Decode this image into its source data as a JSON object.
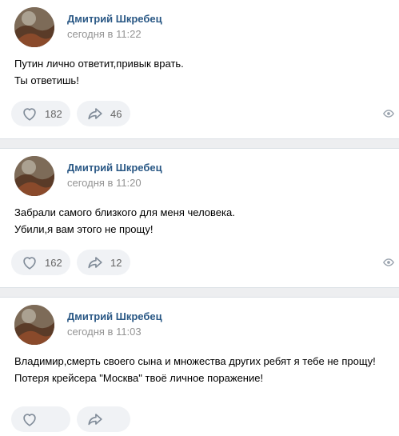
{
  "posts": [
    {
      "author": "Дмитрий Шкребец",
      "time": "сегодня в 11:22",
      "lines": [
        "Путин лично ответит,привык врать.",
        "Ты ответишь!"
      ],
      "likes": "182",
      "shares": "46"
    },
    {
      "author": "Дмитрий Шкребец",
      "time": "сегодня в 11:20",
      "lines": [
        "Забрали самого близкого для меня человека.",
        "Убили,я вам этого не прощу!"
      ],
      "likes": "162",
      "shares": "12"
    },
    {
      "author": "Дмитрий Шкребец",
      "time": "сегодня в 11:03",
      "lines": [
        "Владимир,смерть своего сына и множества других ребят я тебе не прощу!",
        "Потеря крейсера \"Москва\" твоё личное поражение!"
      ],
      "likes": "",
      "shares": ""
    }
  ],
  "icons": {
    "like": "heart-outline-icon",
    "share": "share-arrow-icon",
    "views": "eye-icon"
  },
  "colors": {
    "author": "#2a5885",
    "meta": "#939393",
    "button_bg": "#f0f2f5",
    "separator": "#edeef0"
  }
}
